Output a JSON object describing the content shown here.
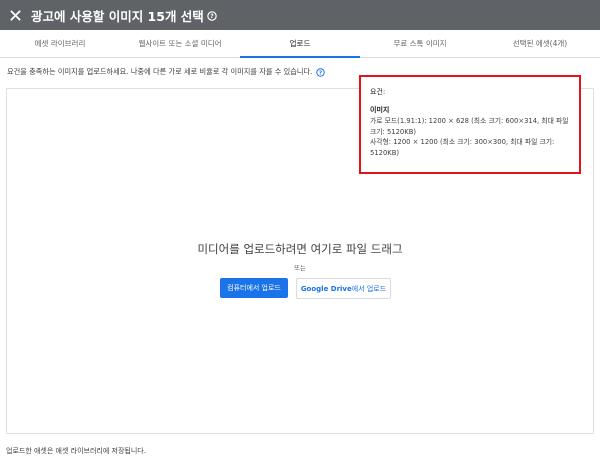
{
  "header": {
    "title": "광고에 사용할 이미지 15개 선택",
    "close_icon": "close-icon",
    "help_icon": "help-icon"
  },
  "tabs": [
    {
      "label": "에셋 라이브러리",
      "active": false
    },
    {
      "label": "웹사이트 또는 소셜 미디어",
      "active": false
    },
    {
      "label": "업로드",
      "active": true
    },
    {
      "label": "무료 스톡 이미지",
      "active": false
    },
    {
      "label": "선택된 에셋(4개)",
      "active": false
    }
  ],
  "upload": {
    "instruction": "요건을 충족하는 이미지를 업로드하세요. 나중에 다른 가로 세로 비율로 각 이미지를 자를 수 있습니다.",
    "drop_text": "미디어를 업로드하려면 여기로 파일 드래그",
    "or_text": "또는",
    "upload_button": "컴퓨터에서 업로드",
    "drive_button_brand": "Google Drive",
    "drive_button_suffix": "에서 업로드"
  },
  "requirements": {
    "heading": "요건:",
    "subheading": "이미지",
    "lines": [
      "가로 모드(1.91:1): 1200 × 628 (최소 크기: 600×314, 최대 파일",
      "크기: 5120KB)",
      "사각형: 1200 × 1200 (최소 크기: 300×300, 최대 파일 크기:",
      "5120KB)"
    ],
    "highlight_color": "#e0141b"
  },
  "footer": {
    "note": "업로드한 애셋은 애셋 라이브러리에 저장됩니다."
  },
  "colors": {
    "header_bg": "#5f6368",
    "accent": "#1a73e8"
  }
}
